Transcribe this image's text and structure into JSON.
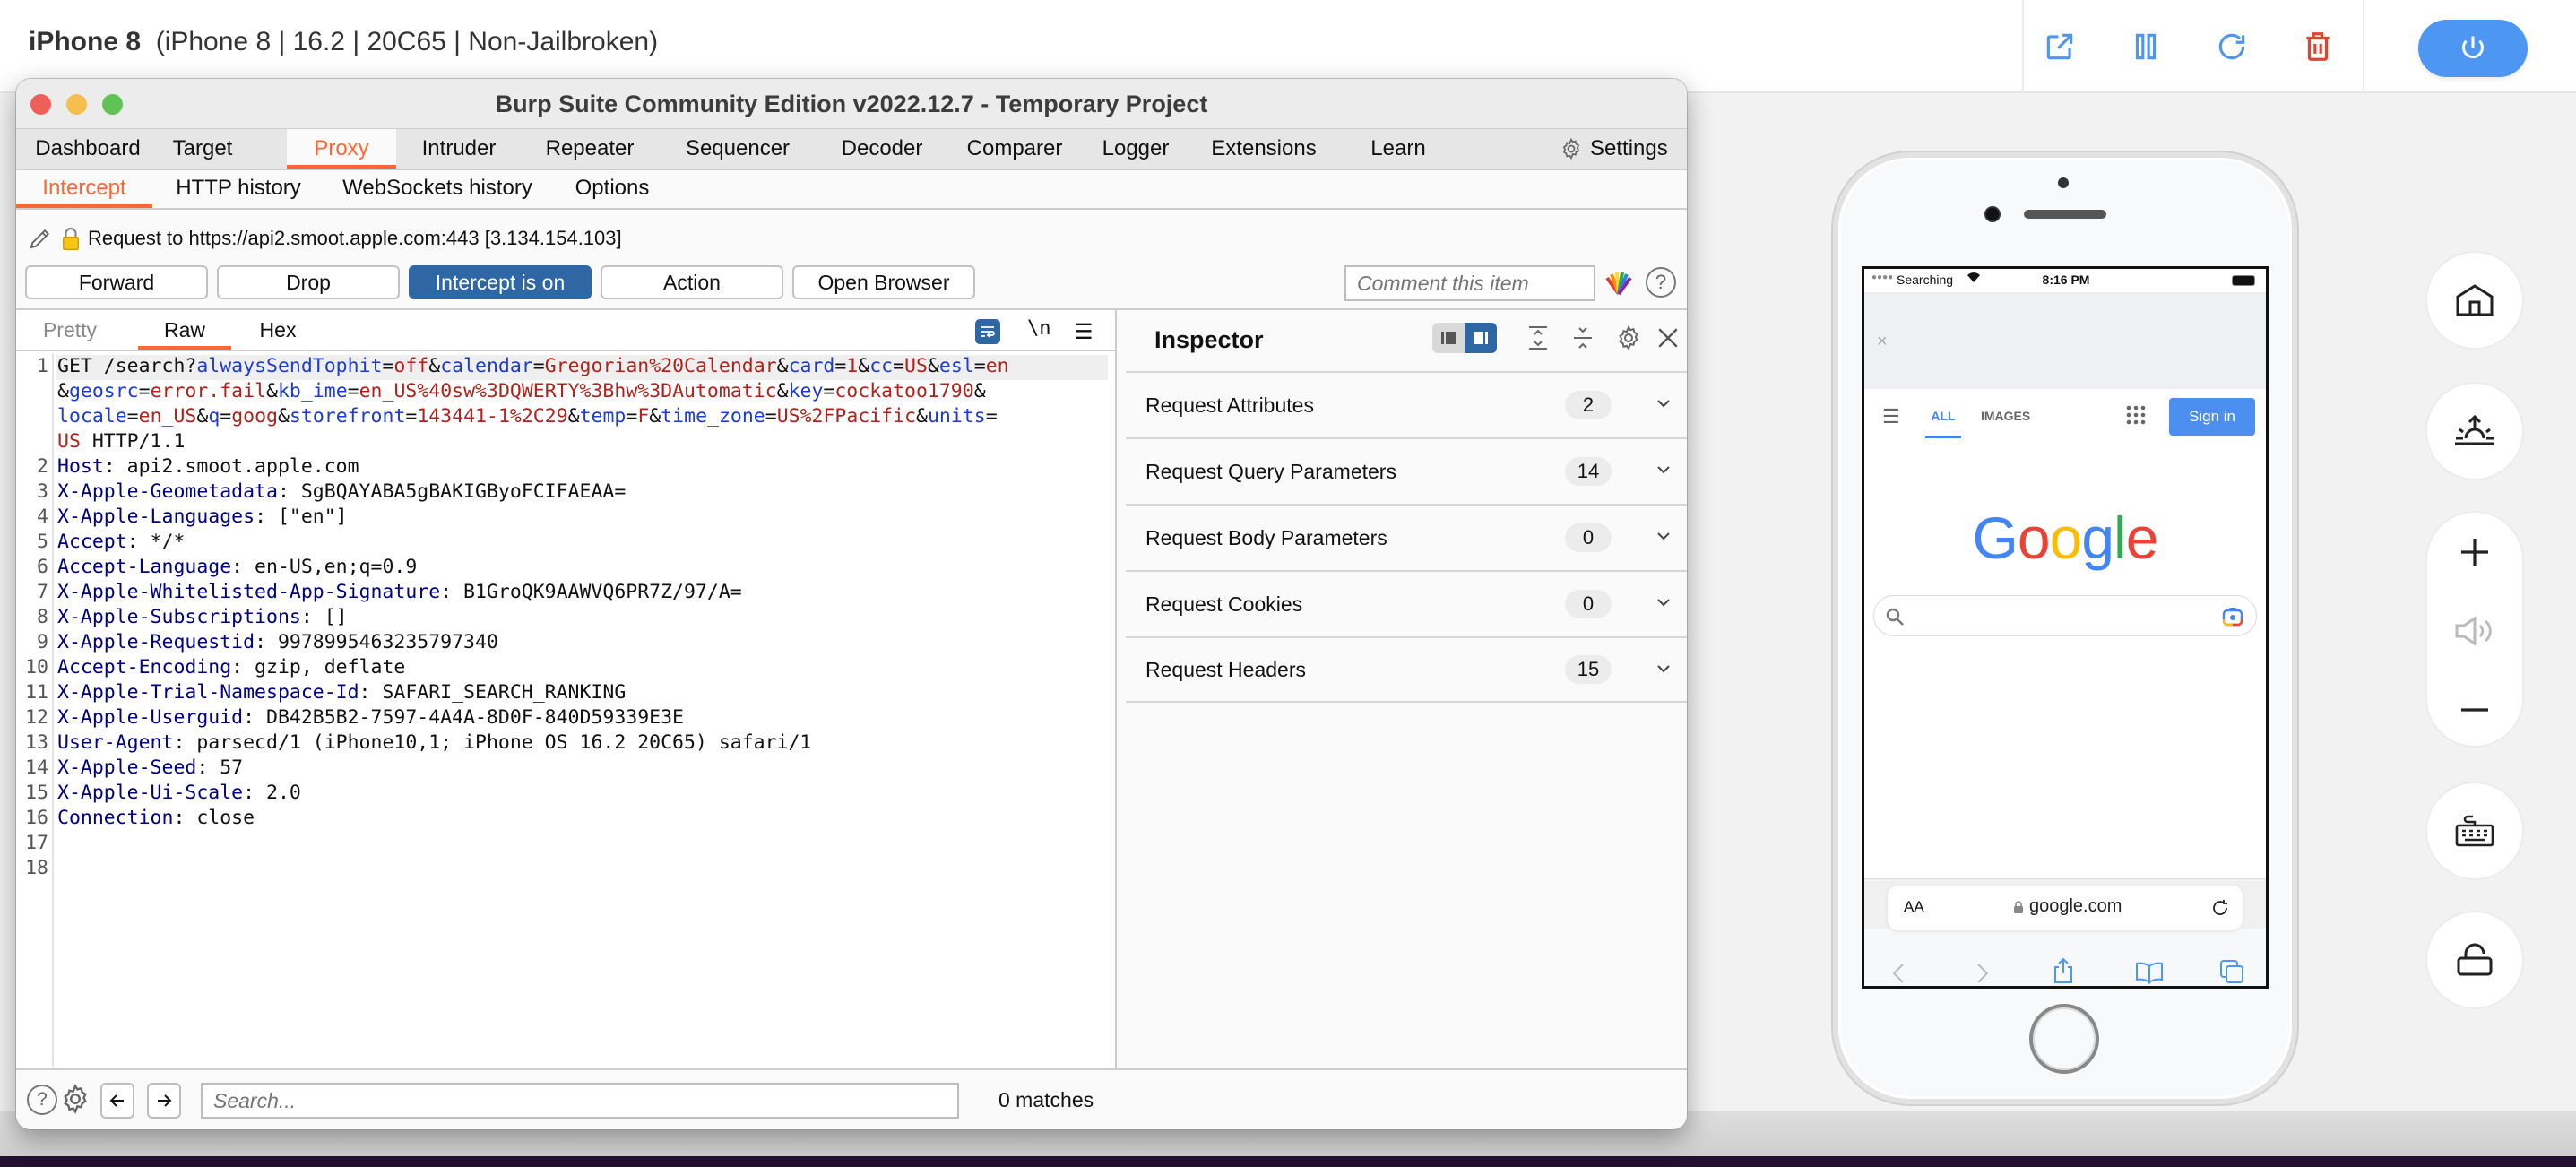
{
  "header": {
    "device_name": "iPhone 8",
    "device_details": "(iPhone 8 | 16.2 | 20C65 | Non-Jailbroken)",
    "icons": [
      "external-link-icon",
      "pause-icon",
      "refresh-icon",
      "trash-icon",
      "power-icon"
    ],
    "colors": {
      "accent": "#4d97f3",
      "danger": "#e0442c"
    }
  },
  "burp": {
    "window_title": "Burp Suite Community Edition v2022.12.7 - Temporary Project",
    "main_tabs": [
      "Dashboard",
      "Target",
      "Proxy",
      "Intruder",
      "Repeater",
      "Sequencer",
      "Decoder",
      "Comparer",
      "Logger",
      "Extensions",
      "Learn"
    ],
    "active_main_tab": "Proxy",
    "settings_label": "Settings",
    "sub_tabs": [
      "Intercept",
      "HTTP history",
      "WebSockets history",
      "Options"
    ],
    "active_sub_tab": "Intercept",
    "request_info": "Request to https://api2.smoot.apple.com:443  [3.134.154.103]",
    "buttons": {
      "forward": "Forward",
      "drop": "Drop",
      "intercept": "Intercept is on",
      "action": "Action",
      "open_browser": "Open Browser"
    },
    "comment_placeholder": "Comment this item",
    "accent_color": "#ff6633",
    "intercept_on_color": "#2f66a4",
    "editor": {
      "tabs": [
        "Pretty",
        "Raw",
        "Hex"
      ],
      "active_tab": "Raw",
      "wrap_icon": "wrap-lines-icon",
      "newline_label": "\\n",
      "menu_icon": "hamburger-menu-icon",
      "request_line": {
        "method": "GET",
        "path": "/search?",
        "params": [
          {
            "k": "alwaysSendTophit",
            "v": "off"
          },
          {
            "k": "calendar",
            "v": "Gregorian%20Calendar"
          },
          {
            "k": "card",
            "v": "1"
          },
          {
            "k": "cc",
            "v": "US"
          },
          {
            "k": "esl",
            "v": "en"
          },
          {
            "k": "geosrc",
            "v": "error.fail"
          },
          {
            "k": "kb_ime",
            "v": "en_US%40sw%3DQWERTY%3Bhw%3DAutomatic"
          },
          {
            "k": "key",
            "v": "cockatoo1790"
          },
          {
            "k": "locale",
            "v": "en_US"
          },
          {
            "k": "q",
            "v": "goog"
          },
          {
            "k": "storefront",
            "v": "143441-1%2C29"
          },
          {
            "k": "temp",
            "v": "F"
          },
          {
            "k": "time_zone",
            "v": "US%2FPacific"
          },
          {
            "k": "units",
            "v": "US"
          }
        ],
        "protocol": "HTTP/1.1"
      },
      "headers": [
        {
          "n": "Host",
          "v": "api2.smoot.apple.com"
        },
        {
          "n": "X-Apple-Geometadata",
          "v": "SgBQAYABA5gBAKIGByoFCIFAEAA="
        },
        {
          "n": "X-Apple-Languages",
          "v": "[\"en\"]"
        },
        {
          "n": "Accept",
          "v": "*/*"
        },
        {
          "n": "Accept-Language",
          "v": "en-US,en;q=0.9"
        },
        {
          "n": "X-Apple-Whitelisted-App-Signature",
          "v": "B1GroQK9AAWVQ6PR7Z/97/A="
        },
        {
          "n": "X-Apple-Subscriptions",
          "v": "[]"
        },
        {
          "n": "X-Apple-Requestid",
          "v": "9978995463235797340"
        },
        {
          "n": "Accept-Encoding",
          "v": "gzip, deflate"
        },
        {
          "n": "X-Apple-Trial-Namespace-Id",
          "v": "SAFARI_SEARCH_RANKING"
        },
        {
          "n": "X-Apple-Userguid",
          "v": "DB42B5B2-7597-4A4A-8D0F-840D59339E3E"
        },
        {
          "n": "User-Agent",
          "v": "parsecd/1 (iPhone10,1; iPhone OS 16.2 20C65) safari/1"
        },
        {
          "n": "X-Apple-Seed",
          "v": "57"
        },
        {
          "n": "X-Apple-Ui-Scale",
          "v": "2.0"
        },
        {
          "n": "Connection",
          "v": "close"
        }
      ],
      "line_numbers": [
        "1",
        "2",
        "3",
        "4",
        "5",
        "6",
        "7",
        "8",
        "9",
        "10",
        "11",
        "12",
        "13",
        "14",
        "15",
        "16",
        "17",
        "18"
      ]
    },
    "inspector": {
      "title": "Inspector",
      "sections": [
        {
          "label": "Request Attributes",
          "count": "2"
        },
        {
          "label": "Request Query Parameters",
          "count": "14"
        },
        {
          "label": "Request Body Parameters",
          "count": "0"
        },
        {
          "label": "Request Cookies",
          "count": "0"
        },
        {
          "label": "Request Headers",
          "count": "15"
        }
      ]
    },
    "search": {
      "placeholder": "Search...",
      "matches": "0 matches"
    }
  },
  "phone": {
    "status": {
      "carrier": "Searching",
      "time": "8:16 PM"
    },
    "google_nav": {
      "all": "ALL",
      "images": "IMAGES",
      "sign_in": "Sign in"
    },
    "logo": {
      "letters": [
        "G",
        "o",
        "o",
        "g",
        "l",
        "e"
      ],
      "colors": [
        "#4285f4",
        "#ea4335",
        "#fbbc05",
        "#4285f4",
        "#34a853",
        "#ea4335"
      ]
    },
    "url_bar": {
      "aa": "AA",
      "url": "google.com"
    }
  },
  "controls": [
    "home-icon",
    "screenshot-icon",
    "volume-up-icon",
    "volume-icon",
    "volume-down-icon",
    "keyboard-icon",
    "unlock-icon"
  ]
}
